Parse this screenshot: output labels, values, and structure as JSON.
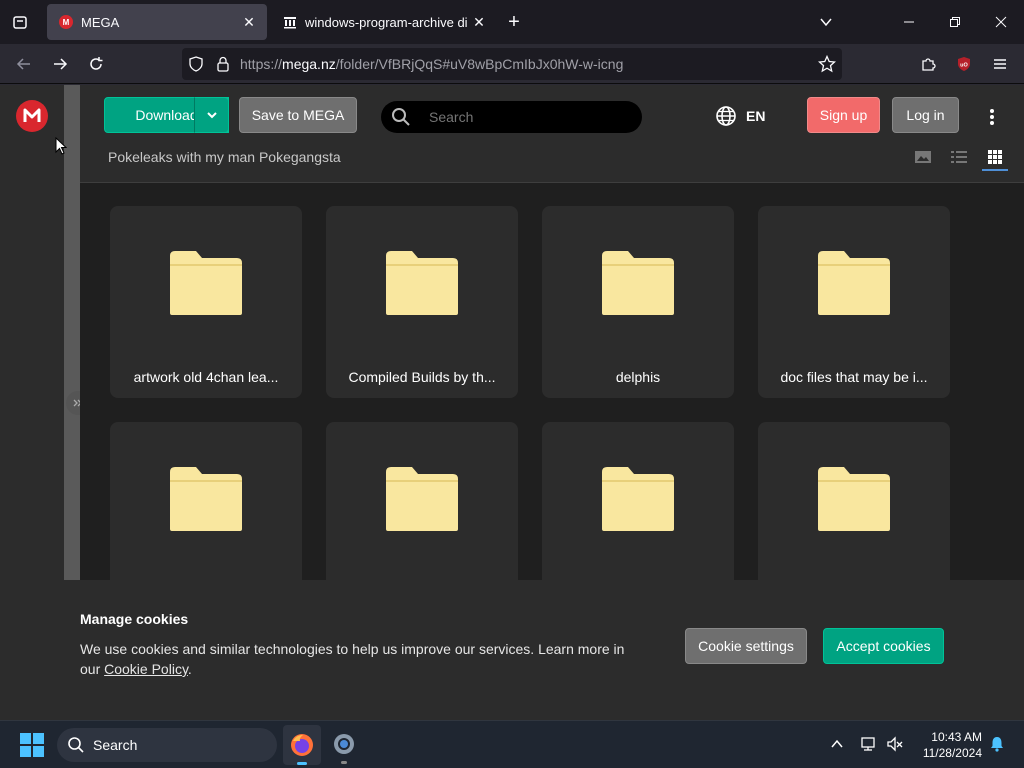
{
  "browser": {
    "tabs": [
      {
        "title": "MEGA",
        "active": true
      },
      {
        "title": "windows-program-archive dire",
        "active": false
      }
    ],
    "url": {
      "scheme": "https://",
      "host": "mega.nz",
      "path": "/folder/VfBRjQqS#uV8wBpCmIbJx0hW-w-icng"
    },
    "new_tab_label": "+"
  },
  "toolbar": {
    "download_label": "Download",
    "save_label": "Save to MEGA",
    "search_placeholder": "Search",
    "language": "EN",
    "signup_label": "Sign up",
    "login_label": "Log in",
    "breadcrumb": "Pokeleaks with my man Pokegangsta"
  },
  "folders": [
    {
      "name": "artwork old 4chan lea..."
    },
    {
      "name": "Compiled Builds by th..."
    },
    {
      "name": "delphis"
    },
    {
      "name": "doc files that may be i..."
    },
    {
      "name": ""
    },
    {
      "name": ""
    },
    {
      "name": ""
    },
    {
      "name": ""
    }
  ],
  "cookies": {
    "title": "Manage cookies",
    "text": "We use cookies and similar technologies to help us improve our services. Learn more in",
    "text_prefix": "our",
    "link": "Cookie Policy",
    "text_suffix": ".",
    "settings_label": "Cookie settings",
    "accept_label": "Accept cookies"
  },
  "taskbar": {
    "search_label": "Search",
    "time": "10:43 AM",
    "date": "11/28/2024"
  },
  "colors": {
    "mega_red": "#d9272e",
    "accent_green": "#00a382",
    "folder": "#f9e79f"
  }
}
